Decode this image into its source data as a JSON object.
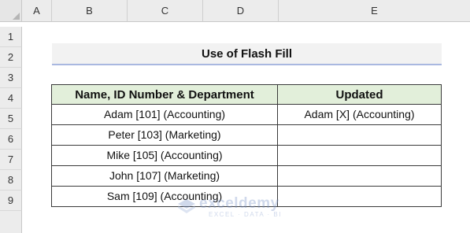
{
  "columns": [
    "A",
    "B",
    "C",
    "D",
    "E"
  ],
  "rows": [
    "1",
    "2",
    "3",
    "4",
    "5",
    "6",
    "7",
    "8",
    "9"
  ],
  "title": "Use of Flash Fill",
  "table": {
    "headers": [
      "Name, ID Number & Department",
      "Updated"
    ],
    "rows": [
      [
        "Adam [101] (Accounting)",
        "Adam [X] (Accounting)"
      ],
      [
        "Peter [103] (Marketing)",
        ""
      ],
      [
        "Mike [105] (Accounting)",
        ""
      ],
      [
        "John [107] (Marketing)",
        ""
      ],
      [
        "Sam [109] (Accounting)",
        ""
      ]
    ]
  },
  "watermark": {
    "name": "exceldemy",
    "tagline": "EXCEL · DATA · BI"
  },
  "colors": {
    "header_fill": "#e2efda",
    "title_fill": "#f2f2f2",
    "title_underline": "#a9b8e0"
  }
}
